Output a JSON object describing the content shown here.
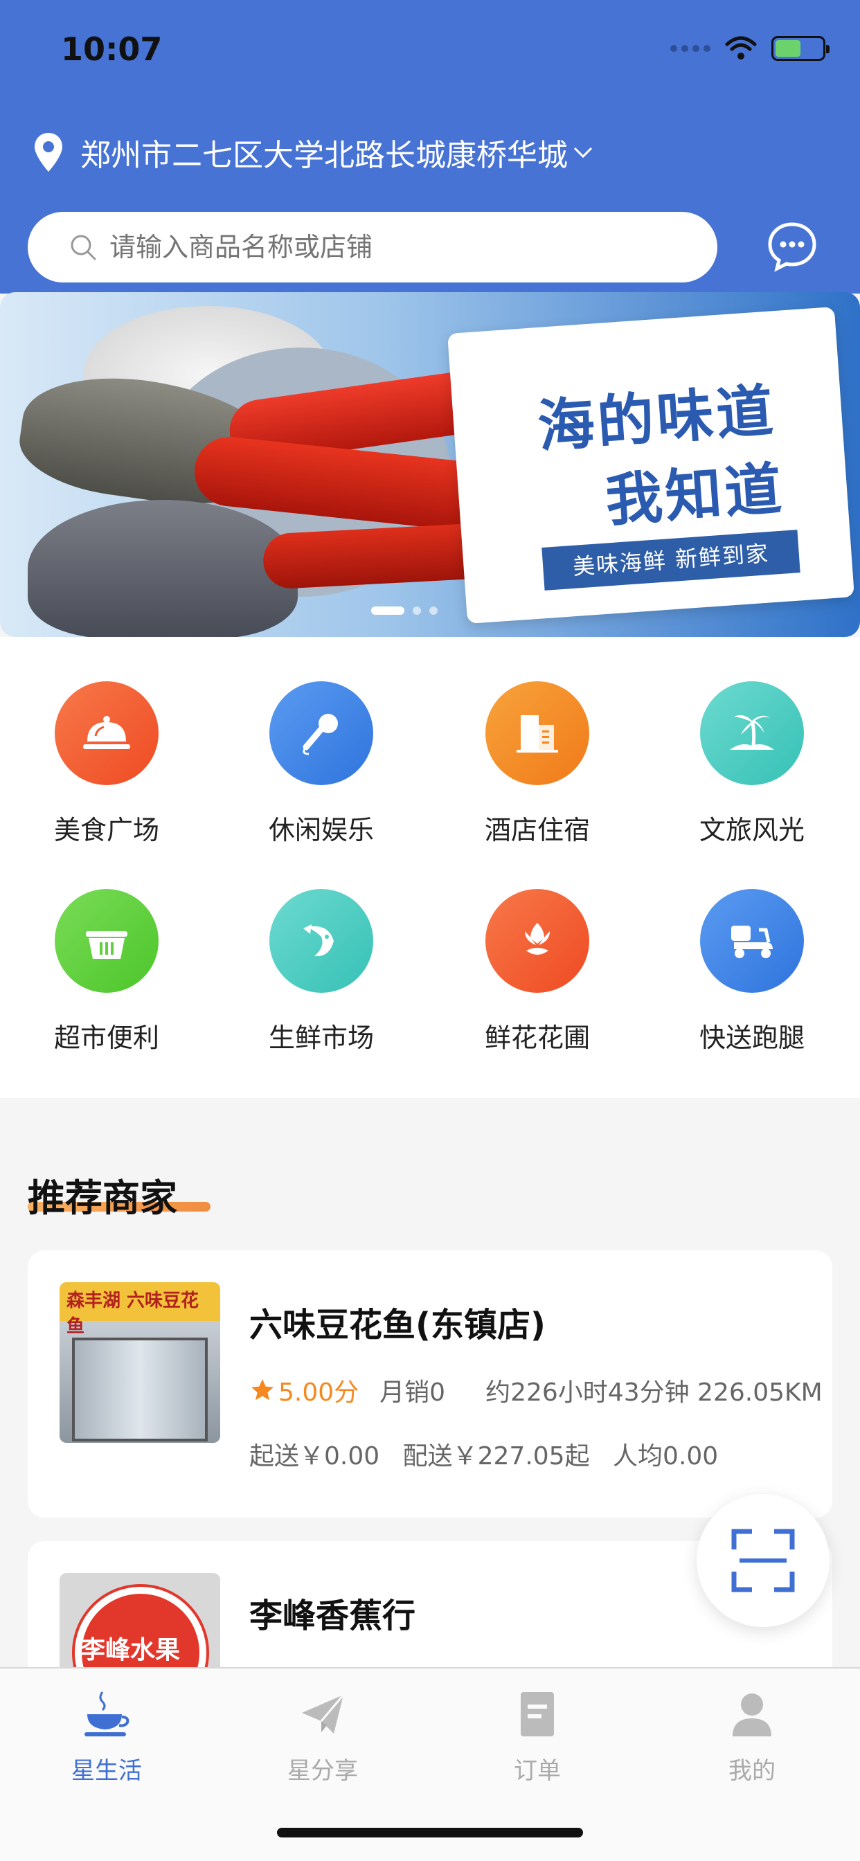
{
  "status_bar": {
    "time": "10:07"
  },
  "location": {
    "address": "郑州市二七区大学北路长城康桥华城"
  },
  "search": {
    "placeholder": "请输入商品名称或店铺"
  },
  "banner": {
    "slogan_line1": "海的味道",
    "slogan_line2": "我知道",
    "tagline": "美味海鲜 新鲜到家",
    "slide_count": 3,
    "active_slide": 1
  },
  "categories": [
    {
      "label": "美食广场",
      "icon": "cloche-icon",
      "color": "#F3582F"
    },
    {
      "label": "休闲娱乐",
      "icon": "microphone-icon",
      "color": "#3E87E8"
    },
    {
      "label": "酒店住宿",
      "icon": "hotel-icon",
      "color": "#F5861F"
    },
    {
      "label": "文旅风光",
      "icon": "palm-island-icon",
      "color": "#4CCFC4"
    },
    {
      "label": "超市便利",
      "icon": "basket-icon",
      "color": "#62CF3E"
    },
    {
      "label": "生鲜市场",
      "icon": "fish-icon",
      "color": "#4CCFC4"
    },
    {
      "label": "鲜花花圃",
      "icon": "tulip-icon",
      "color": "#F3582F"
    },
    {
      "label": "快送跑腿",
      "icon": "scooter-icon",
      "color": "#3E87E8"
    }
  ],
  "recommend": {
    "title": "推荐商家",
    "merchants": [
      {
        "name": "六味豆花鱼(东镇店)",
        "rating": "5.00分",
        "monthly_sales": "月销0",
        "eta_distance": "约226小时43分钟 226.05KM",
        "min_order": "起送￥0.00",
        "delivery_fee": "配送￥227.05起",
        "per_capita": "人均0.00",
        "thumb_sign": "森丰湖  六味豆花鱼"
      },
      {
        "name": "李峰香蕉行",
        "thumb_sign": "李峰水果"
      }
    ]
  },
  "tabbar": {
    "items": [
      {
        "label": "星生活",
        "icon": "coffee-cup-icon",
        "active": true
      },
      {
        "label": "星分享",
        "icon": "paper-plane-icon",
        "active": false
      },
      {
        "label": "订单",
        "icon": "order-icon",
        "active": false
      },
      {
        "label": "我的",
        "icon": "profile-icon",
        "active": false
      }
    ]
  },
  "colors": {
    "header_bg": "#4673D4",
    "accent_orange": "#F5891F",
    "tab_active": "#3F6FD3"
  }
}
